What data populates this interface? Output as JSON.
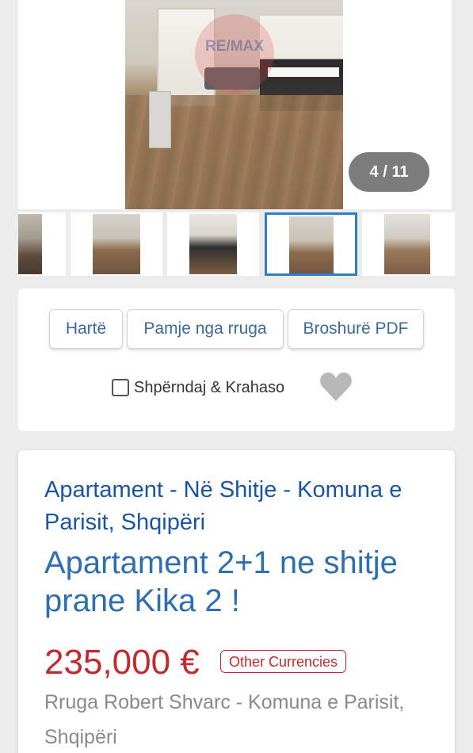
{
  "gallery": {
    "counter": "4 / 11",
    "watermark": "RE/MAX",
    "thumbnails": [
      "thumb-1",
      "thumb-2",
      "thumb-3",
      "thumb-4",
      "thumb-5"
    ],
    "active_thumbnail": 4
  },
  "actions": {
    "map_label": "Hartë",
    "street_view_label": "Pamje nga rruga",
    "brochure_label": "Broshurë PDF",
    "compare_label": "Shpërndaj & Krahaso",
    "favorite_icon": "heart-icon"
  },
  "listing": {
    "subtitle": "Apartament - Në Shitje - Komuna e Parisit, Shqipëri",
    "title": "Apartament 2+1 ne shitje prane Kika 2 !",
    "price": "235,000 €",
    "currency_button": "Other Currencies",
    "address": "Rruga Robert Shvarc - Komuna e Parisit, Shqipëri"
  },
  "colors": {
    "accent_blue": "#1a55a5",
    "price_red": "#c22a2f",
    "active_thumb_border": "#2d7ec4"
  }
}
